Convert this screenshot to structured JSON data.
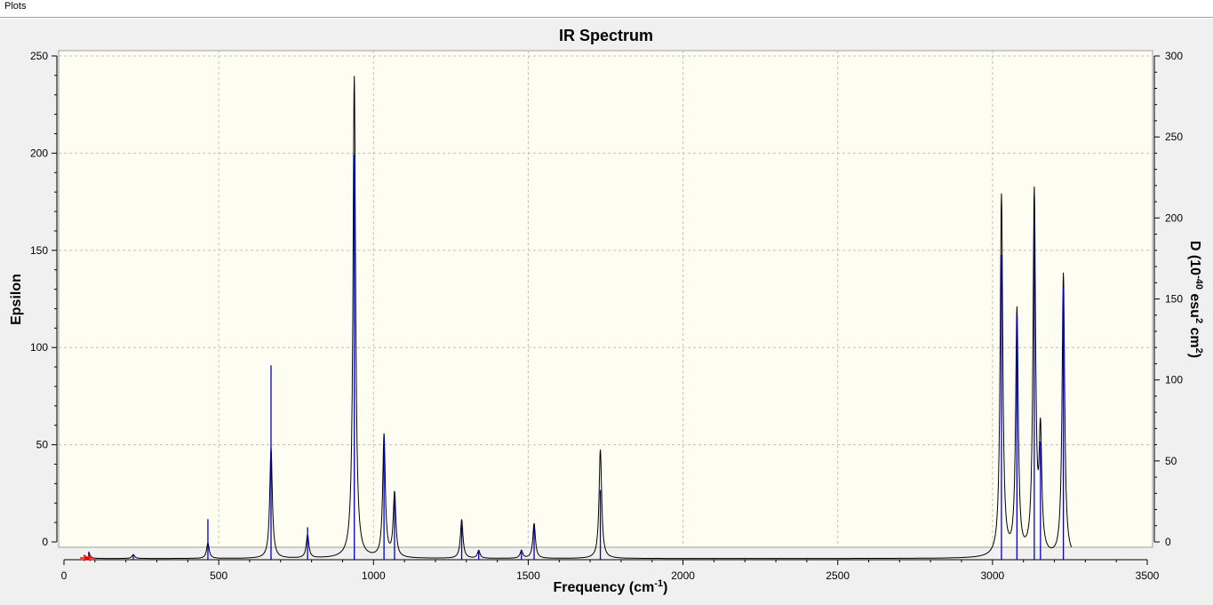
{
  "window": {
    "tab_label": "Plots"
  },
  "chart_data": {
    "type": "line",
    "title": "IR Spectrum",
    "xlabel": "Frequency (cm",
    "xlabel_sup": "-1",
    "xlabel_tail": ")",
    "ylabel": "Epsilon",
    "y2label_parts": [
      "D (10",
      "-40",
      " esu",
      "2",
      " cm",
      "2",
      ")"
    ],
    "xlim": [
      0,
      3500
    ],
    "ylim": [
      0,
      250
    ],
    "y2lim": [
      0,
      300
    ],
    "x_ticks": [
      0,
      500,
      1000,
      1500,
      2000,
      2500,
      3000,
      3500
    ],
    "y_ticks": [
      0,
      50,
      100,
      150,
      200,
      250
    ],
    "y2_ticks": [
      0,
      50,
      100,
      150,
      200,
      250,
      300
    ],
    "grid": true,
    "colors": {
      "spectrum": "#000000",
      "sticks": "#0000cc",
      "plot_bg": "#fdfdf1",
      "marker": "#ff0000"
    },
    "marker_x": 75,
    "peaks": [
      {
        "x": 80,
        "eps": 3,
        "d": 5
      },
      {
        "x": 224,
        "eps": 2,
        "d": 3
      },
      {
        "x": 465,
        "eps": 8,
        "d": 25
      },
      {
        "x": 669,
        "eps": 57,
        "d": 120
      },
      {
        "x": 787,
        "eps": 12,
        "d": 20
      },
      {
        "x": 938,
        "eps": 248,
        "d": 250
      },
      {
        "x": 1034,
        "eps": 63,
        "d": 76
      },
      {
        "x": 1068,
        "eps": 33,
        "d": 38
      },
      {
        "x": 1285,
        "eps": 20,
        "d": 22
      },
      {
        "x": 1340,
        "eps": 4,
        "d": 5
      },
      {
        "x": 1478,
        "eps": 4,
        "d": 5
      },
      {
        "x": 1519,
        "eps": 18,
        "d": 20
      },
      {
        "x": 1733,
        "eps": 56,
        "d": 43
      },
      {
        "x": 3029,
        "eps": 186,
        "d": 188
      },
      {
        "x": 3079,
        "eps": 126,
        "d": 151
      },
      {
        "x": 3135,
        "eps": 186,
        "d": 210
      },
      {
        "x": 3155,
        "eps": 60,
        "d": 73
      },
      {
        "x": 3229,
        "eps": 146,
        "d": 168
      }
    ]
  }
}
